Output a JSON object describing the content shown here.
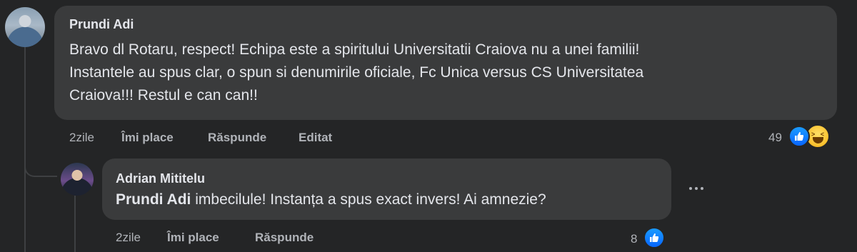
{
  "comment": {
    "author": "Prundi Adi",
    "lines": [
      "Bravo dl Rotaru, respect! Echipa este a spiritului Universitatii Craiova nu a unei familii!",
      "Instantele au spus clar, o spun si denumirile oficiale, Fc Unica versus CS Universitatea",
      "Craiova!!! Restul e can can!!"
    ],
    "time": "2zile",
    "like_label": "Îmi place",
    "reply_label": "Răspunde",
    "edited_label": "Editat",
    "reaction_count": "49",
    "reactions": [
      "like-icon",
      "haha-icon"
    ]
  },
  "reply": {
    "author": "Adrian Mititelu",
    "mention": "Prundi Adi",
    "text": " imbecilule! Instanța a spus exact invers! Ai amnezie?",
    "time": "2zile",
    "like_label": "Îmi place",
    "reply_label": "Răspunde",
    "reaction_count": "8",
    "reactions": [
      "like-icon"
    ]
  },
  "colors": {
    "background": "#242526",
    "bubble": "#3a3b3c",
    "text": "#e4e6eb",
    "secondary_text": "#b0b3b8",
    "like_blue": "#0866ff"
  }
}
